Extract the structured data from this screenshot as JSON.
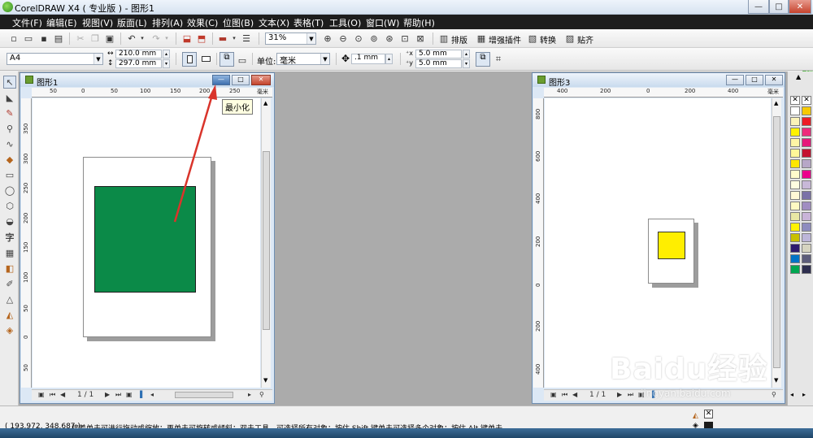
{
  "app": {
    "title": "CorelDRAW X4 ( 专业版 ) - 图形1",
    "window_controls": {
      "minimize": "—",
      "maximize": "□",
      "close": "✕"
    }
  },
  "menubar": {
    "items": [
      "文件(F)",
      "编辑(E)",
      "视图(V)",
      "版面(L)",
      "排列(A)",
      "效果(C)",
      "位图(B)",
      "文本(X)",
      "表格(T)",
      "工具(O)",
      "窗口(W)",
      "帮助(H)"
    ]
  },
  "toolbar": {
    "zoom_level": "31%",
    "paiban_label": "排版",
    "plugin_label": "增强插件",
    "convert_label": "转换",
    "paste_label": "贴齐"
  },
  "propertybar": {
    "paper_size": "A4",
    "width": "210.0 mm",
    "height": "297.0 mm",
    "units_label": "单位:",
    "units_value": "毫米",
    "nudge": ".1 mm",
    "dup_x": "5.0 mm",
    "dup_y": "5.0 mm"
  },
  "doc1": {
    "title": "图形1",
    "tooltip": "最小化",
    "ruler_h": [
      "50",
      "0",
      "50",
      "100",
      "150",
      "200",
      "250"
    ],
    "ruler_unit": "毫米",
    "ruler_v": [
      "350",
      "300",
      "250",
      "200",
      "150",
      "100",
      "50",
      "0",
      "50"
    ],
    "page_counter": "1 / 1",
    "shape_color": "#0b8a48"
  },
  "doc2": {
    "title": "图形3",
    "ruler_h": [
      "400",
      "200",
      "0",
      "200",
      "400"
    ],
    "ruler_unit": "毫米",
    "ruler_v": [
      "800",
      "600",
      "400",
      "200",
      "0",
      "200",
      "400"
    ],
    "page_counter": "1 / 1",
    "shape_color": "#ffee00"
  },
  "palette": {
    "colors": [
      "#ffffff",
      "#fbf3b8",
      "#fff200",
      "#fff5a5",
      "#fff799",
      "#ffe600",
      "#fffbcc",
      "#fffde0",
      "#fff8d6",
      "#fef9c3",
      "#e8e7a5",
      "#fff200",
      "#c8c000",
      "#2e1b6e",
      "#0073c6",
      "#00a651",
      "#f7c900",
      "#ed1c24",
      "#ee2a7b",
      "#e6187a",
      "#c41230",
      "#b7a7c7",
      "#ec008c",
      "#c8b8d8",
      "#7a71a8",
      "#a08dc2",
      "#c9b4d8",
      "#8e8cbf",
      "#bdb6d9",
      "#d6d4c0",
      "#5c5c7a",
      "#2d2d4e"
    ]
  },
  "status": {
    "coordinates": "( 193.972, 348.687 )",
    "message": "接着单击可进行拖动或缩放；再单击可旋转或倾斜；双击工具，可选择所有对象；按住 Shift 键单击可选择多个对象；按住 Alt 键单击..."
  },
  "watermark": {
    "brand": "Baidu经验",
    "url": "jingyan.baidu.com"
  }
}
